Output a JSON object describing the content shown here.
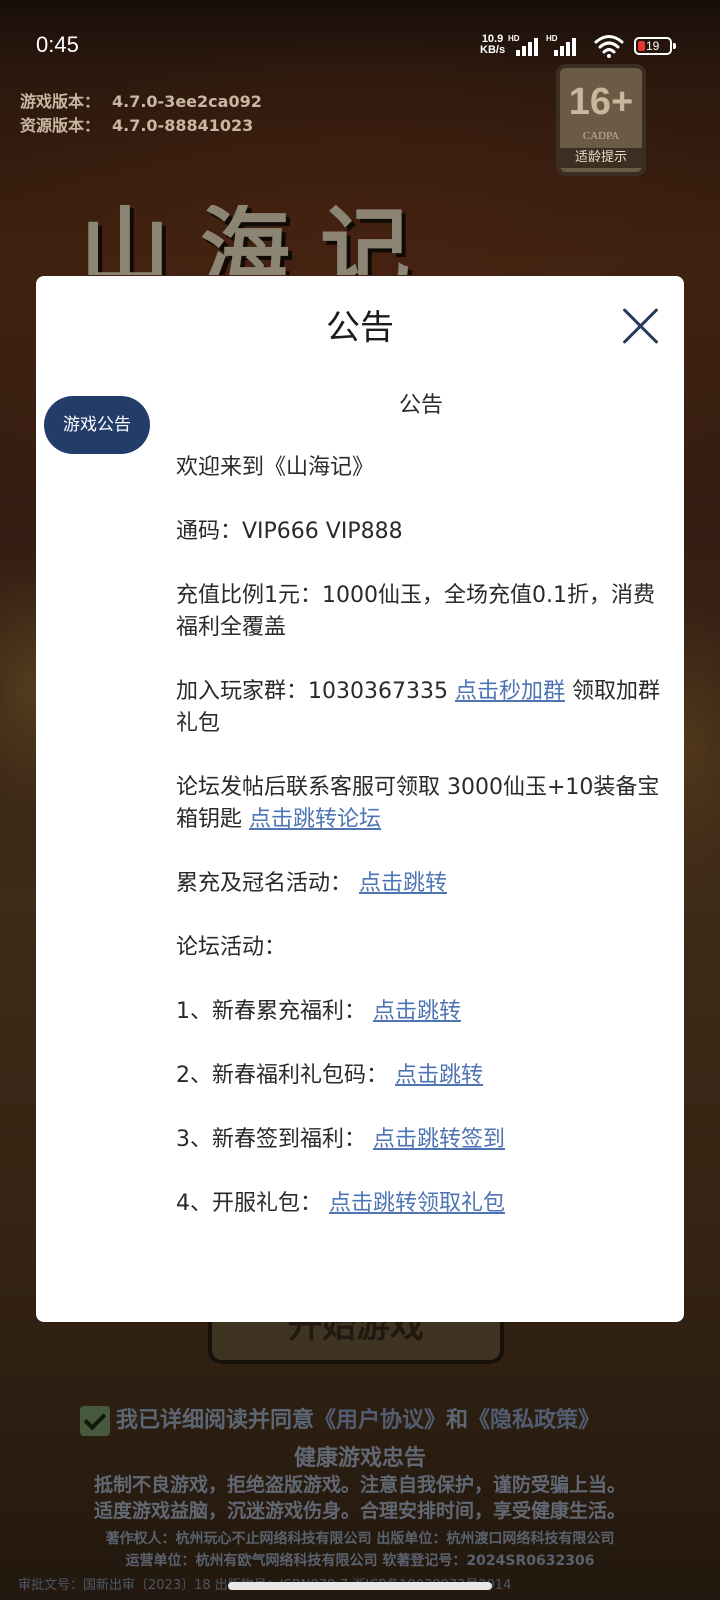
{
  "status_bar": {
    "time": "0:45",
    "net_speed_value": "10.9",
    "net_speed_unit": "KB/s",
    "sim1_label": "HD",
    "sim2_label": "HD",
    "battery_level": "19"
  },
  "versions": {
    "game_key": "游戏版本：",
    "game_value": "4.7.0-3ee2ca092",
    "res_key": "资源版本：",
    "res_value": "4.7.0-88841023"
  },
  "age_badge": {
    "age": "16+",
    "org": "CADPA",
    "tip": "适龄提示"
  },
  "background": {
    "game_title": "山海记",
    "start_button": "开始游戏",
    "agree_text": "我已详细阅读并同意",
    "user_agreement": "《用户协议》",
    "and": "和",
    "privacy_policy": "《隐私政策》",
    "health_title": "健康游戏忠告",
    "health_line1": "抵制不良游戏，拒绝盗版游戏。注意自我保护，谨防受骗上当。",
    "health_line2": "适度游戏益脑，沉迷游戏伤身。合理安排时间，享受健康生活。",
    "credit_line1": "著作权人：杭州玩心不止网络科技有限公司  出版单位：杭州渡口网络科技有限公司",
    "credit_line2": "运营单位：杭州有欧气网络科技有限公司  软著登记号：2024SR0632306",
    "credit_line3": "审批文号：国新出审〔2023〕18   出版物号：ISBN978-7   浙ICP备18038873号2914"
  },
  "modal": {
    "title": "公告",
    "tab_label": "游戏公告",
    "content_heading": "公告",
    "welcome": "欢迎来到《山海记》",
    "code_line": "通码：VIP666 VIP888",
    "recharge_line": "充值比例1元：1000仙玉，全场充值0.1折，消费福利全覆盖",
    "group_prefix": "加入玩家群：1030367335 ",
    "group_link": "点击秒加群",
    "group_suffix": " 领取加群礼包",
    "forum_prefix": "论坛发帖后联系客服可领取 3000仙玉+10装备宝箱钥匙 ",
    "forum_link": "点击跳转论坛",
    "cumulative_prefix": "累充及冠名活动： ",
    "cumulative_link": "点击跳转",
    "forum_events": "论坛活动：",
    "event1_prefix": "1、新春累充福利： ",
    "event1_link": "点击跳转",
    "event2_prefix": "2、新春福利礼包码： ",
    "event2_link": "点击跳转",
    "event3_prefix": "3、新春签到福利： ",
    "event3_link": "点击跳转签到",
    "event4_prefix": "4、开服礼包： ",
    "event4_link": "点击跳转领取礼包"
  },
  "colors": {
    "link": "#4e74b3",
    "tab_bg": "#233d6b",
    "close_icon": "#243b5a",
    "modal_bg": "#ffffff"
  }
}
